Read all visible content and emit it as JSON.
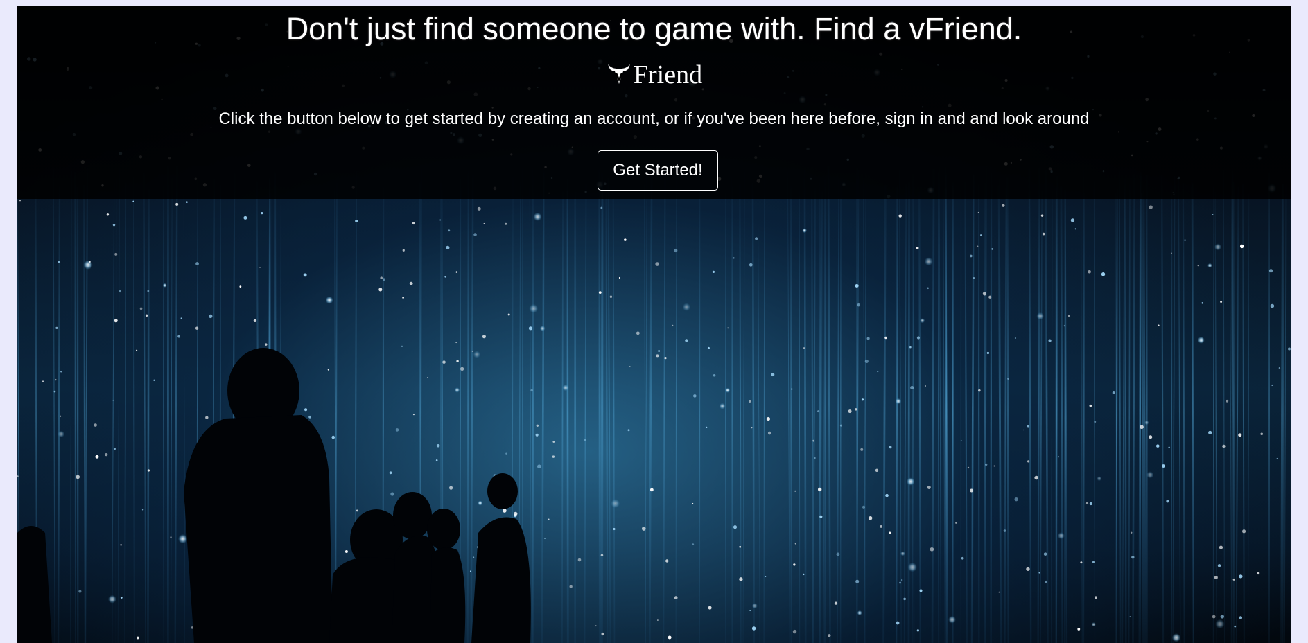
{
  "hero": {
    "headline": "Don't just find someone to game with. Find a vFriend.",
    "logo_text": "Friend",
    "logo_icon": "v-horns-logo-icon",
    "subtitle": "Click the button below to get started by creating an account, or if you've been here before, sign in and and look around",
    "cta_label": "Get Started!",
    "background_image": "silhouettes-in-light-installation"
  },
  "colors": {
    "page_background": "#eaeafc",
    "header_overlay": "#000000",
    "text": "#ffffff",
    "light_accent": "#4fb3e8"
  }
}
